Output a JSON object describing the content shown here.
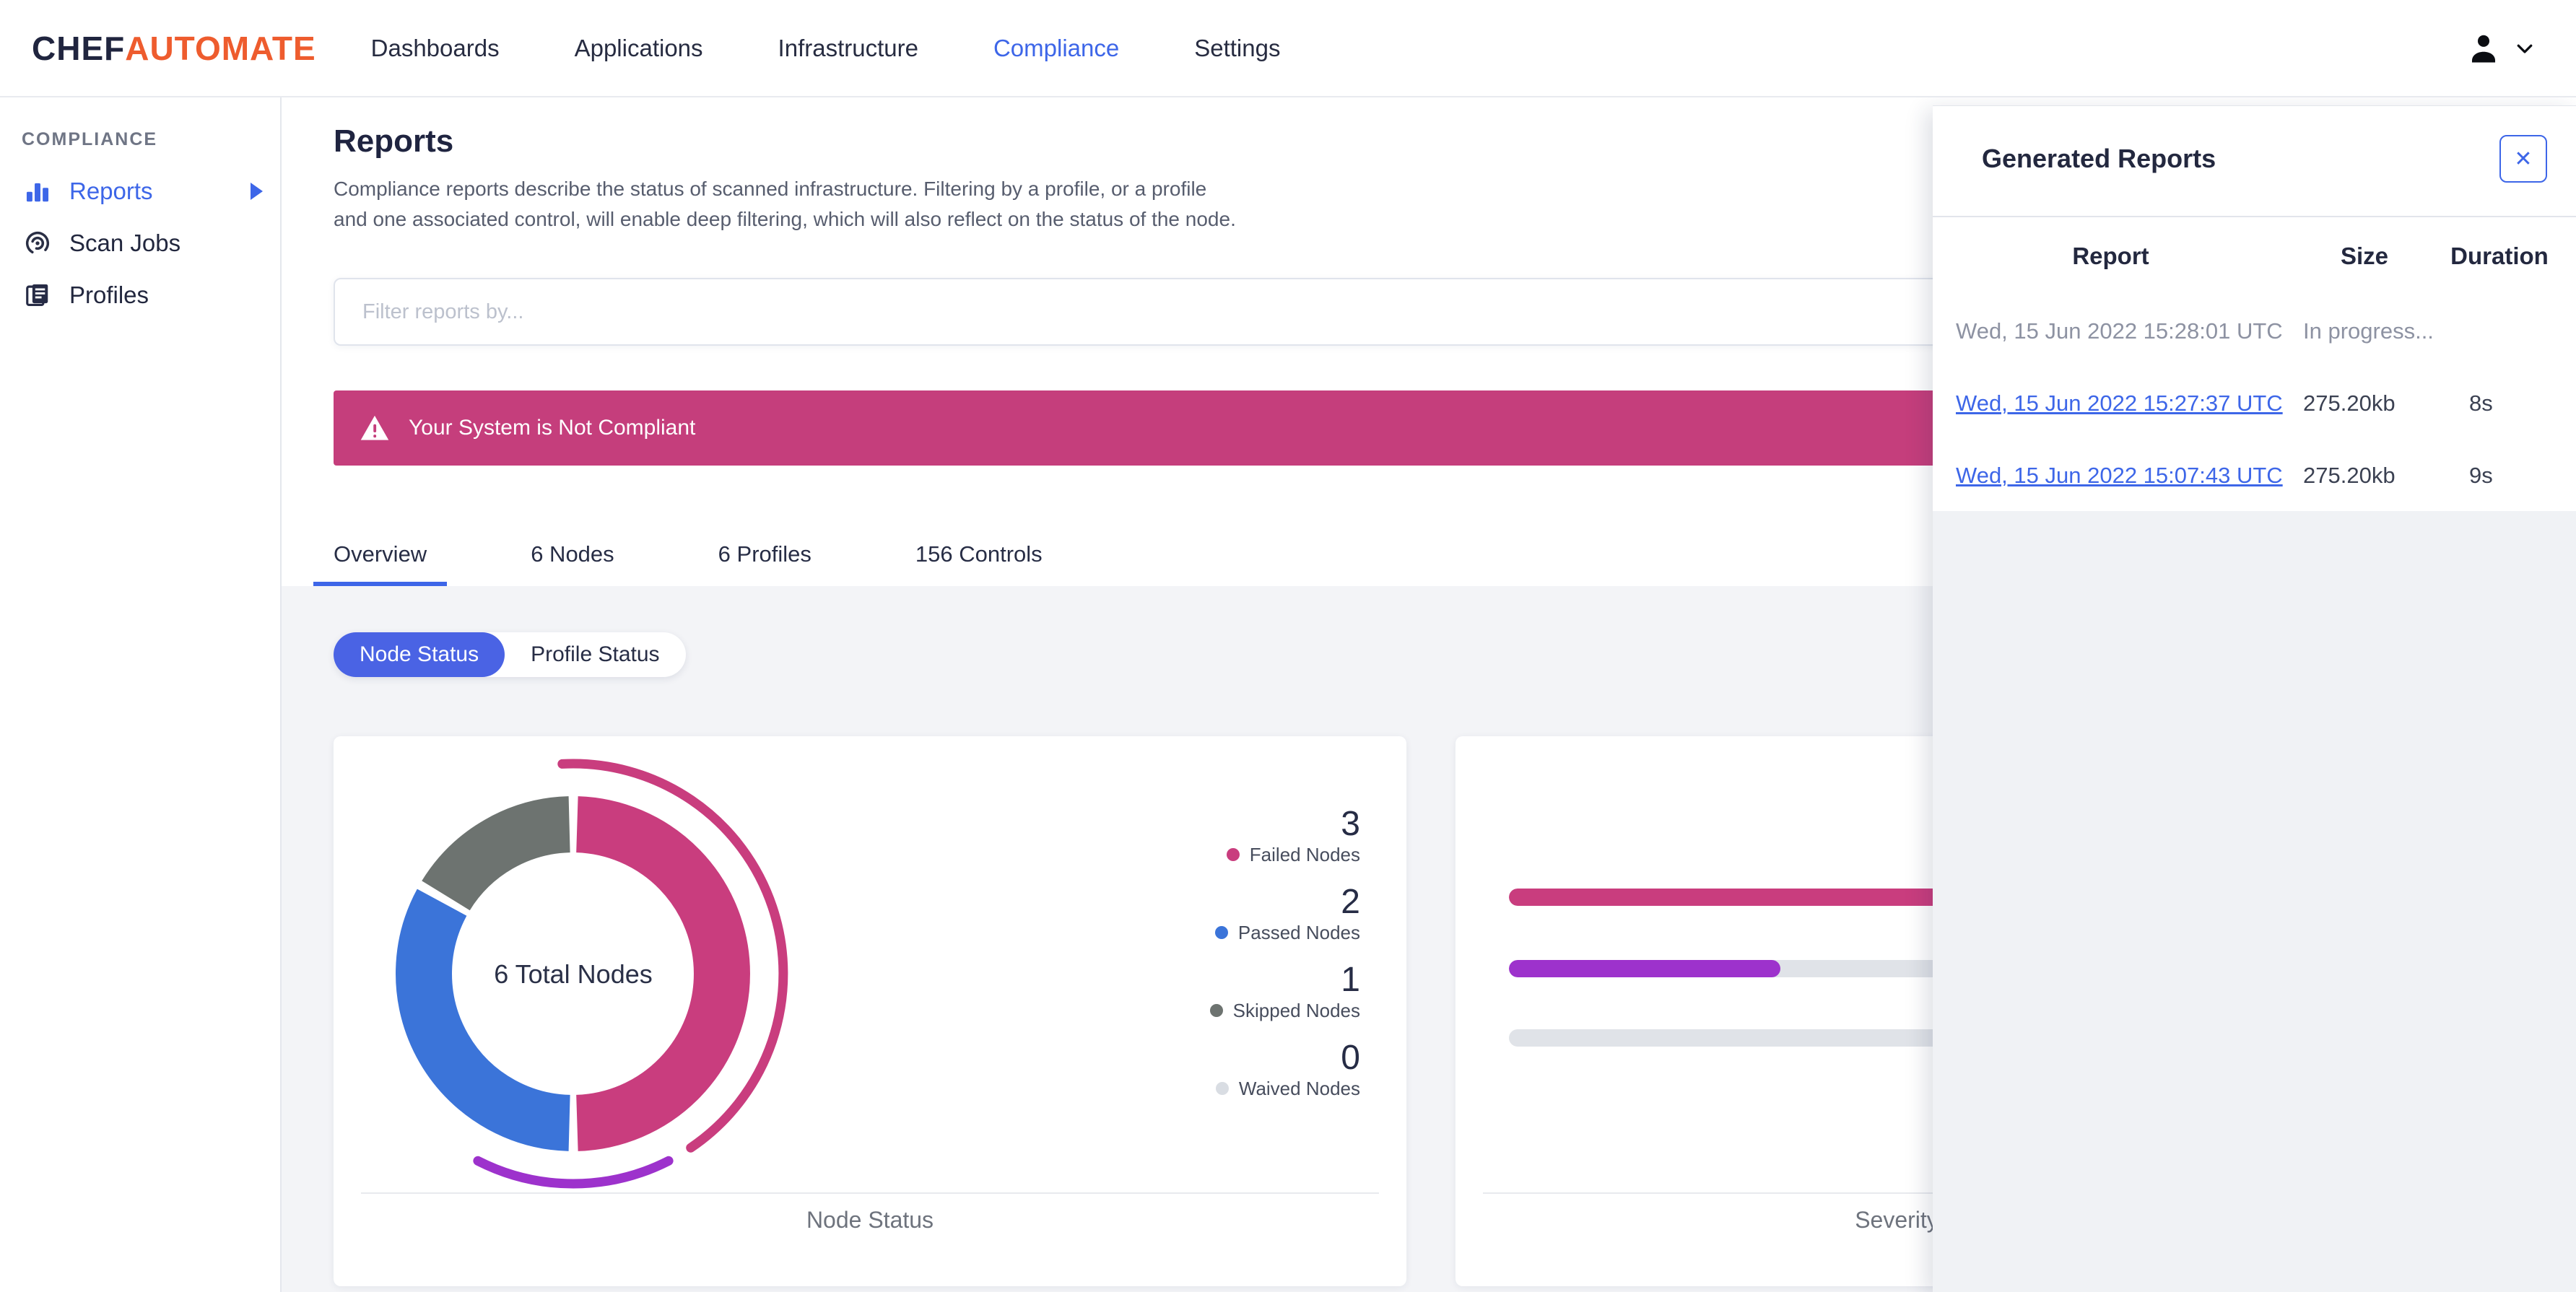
{
  "nav": {
    "brand_chef": "CHEF",
    "brand_automate": "AUTOMATE",
    "items": [
      {
        "label": "Dashboards",
        "active": false
      },
      {
        "label": "Applications",
        "active": false
      },
      {
        "label": "Infrastructure",
        "active": false
      },
      {
        "label": "Compliance",
        "active": true
      },
      {
        "label": "Settings",
        "active": false
      }
    ]
  },
  "sidebar": {
    "section": "COMPLIANCE",
    "items": [
      {
        "label": "Reports",
        "icon": "bar-chart-icon",
        "active": true
      },
      {
        "label": "Scan Jobs",
        "icon": "radar-icon",
        "active": false
      },
      {
        "label": "Profiles",
        "icon": "documents-icon",
        "active": false
      }
    ]
  },
  "page": {
    "title": "Reports",
    "description": "Compliance reports describe the status of scanned infrastructure. Filtering by a profile, or a profile and one associated control, will enable deep filtering, which will also reflect on the status of the node.",
    "filter_placeholder": "Filter reports by...",
    "banner_text": "Your System is Not Compliant",
    "banner_color": "#C53E7C"
  },
  "tabs": [
    {
      "label": "Overview",
      "active": true
    },
    {
      "label": "6 Nodes",
      "active": false
    },
    {
      "label": "6 Profiles",
      "active": false
    },
    {
      "label": "156 Controls",
      "active": false
    }
  ],
  "toggle": [
    {
      "label": "Node Status",
      "active": true
    },
    {
      "label": "Profile Status",
      "active": false
    }
  ],
  "chart_data": [
    {
      "type": "pie",
      "title": "Node Status",
      "center_label": "6 Total Nodes",
      "total": 6,
      "segments": [
        {
          "label": "Failed Nodes",
          "value": 3,
          "color": "#C93D7E"
        },
        {
          "label": "Passed Nodes",
          "value": 2,
          "color": "#3B74D9"
        },
        {
          "label": "Skipped Nodes",
          "value": 1,
          "color": "#6D7370"
        },
        {
          "label": "Waived Nodes",
          "value": 0,
          "color": "#D9DDE3"
        }
      ],
      "outer_arcs": [
        {
          "color": "#C93D7E",
          "start_deg": -3,
          "end_deg": 146
        },
        {
          "color": "#9D32CC",
          "start_deg": 153,
          "end_deg": 207
        }
      ],
      "legend_position": "right"
    },
    {
      "type": "bar",
      "title": "Severity",
      "orientation": "horizontal",
      "track_color": "#E0E3E8",
      "bars": [
        {
          "fraction": 1.0,
          "color": "#C93D7E"
        },
        {
          "fraction": 0.35,
          "color": "#9D32CC"
        },
        {
          "fraction": 0.0,
          "color": "#9D32CC"
        }
      ]
    }
  ],
  "drawer": {
    "title": "Generated Reports",
    "close_glyph": "✕",
    "columns": [
      "Report",
      "Size",
      "Duration"
    ],
    "rows": [
      {
        "report": "Wed, 15 Jun 2022 15:28:01 UTC",
        "size": "In progress...",
        "duration": "",
        "link": false
      },
      {
        "report": "Wed, 15 Jun 2022 15:27:37 UTC",
        "size": "275.20kb",
        "duration": "8s",
        "link": true
      },
      {
        "report": "Wed, 15 Jun 2022 15:07:43 UTC",
        "size": "275.20kb",
        "duration": "9s",
        "link": true
      }
    ]
  },
  "colors": {
    "accent_blue": "#3D66E8",
    "pill_blue": "#4A63E4",
    "banner_magenta": "#C53E7C",
    "page_background": "#F3F4F7"
  }
}
